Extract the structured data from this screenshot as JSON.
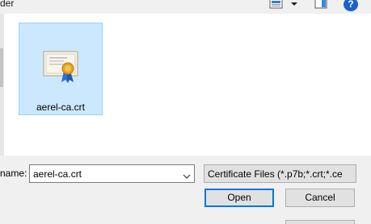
{
  "header": {
    "title_fragment": "der",
    "help_label": "?"
  },
  "toolbar": {
    "view_icon": "view-options-icon",
    "dropdown_icon": "chevron-down-icon",
    "preview_pane_icon": "preview-pane-icon",
    "help_icon": "help-icon"
  },
  "files": [
    {
      "name": "aerel-ca.crt",
      "icon": "certificate-icon",
      "selected": true
    }
  ],
  "footer": {
    "name_label": "name:",
    "filename_value": "aerel-ca.crt",
    "filetype_value": "Certificate Files (*.p7b;*.crt;*.ce",
    "open_label": "Open",
    "cancel_label": "Cancel"
  },
  "colors": {
    "selection_bg": "#cce8ff",
    "selection_border": "#99d1ff",
    "help_blue": "#1b62c9",
    "default_button_border": "#0078d7"
  }
}
